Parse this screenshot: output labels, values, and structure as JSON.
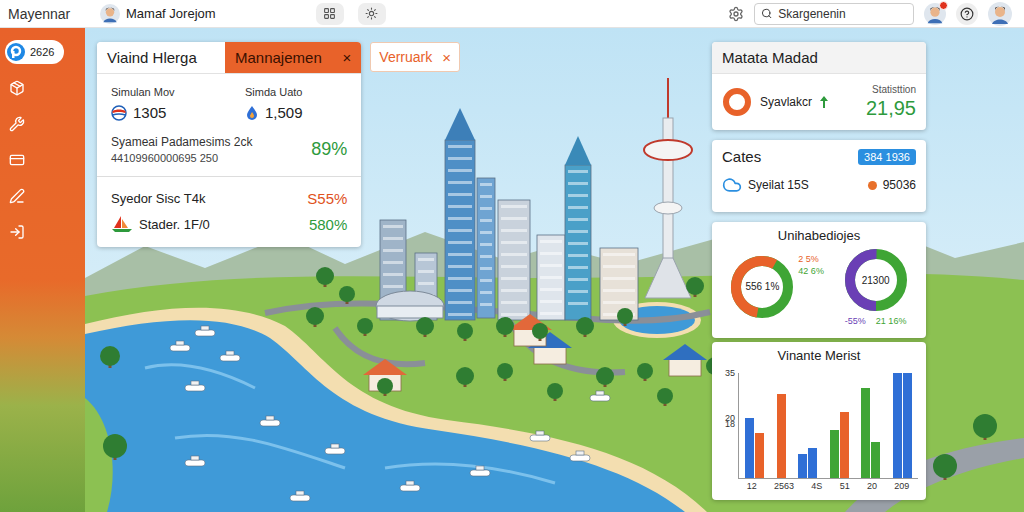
{
  "app": {
    "name": "Mayennar"
  },
  "header": {
    "user": "Mamaf Jorejom",
    "search": {
      "placeholder": "Skargenenin"
    },
    "notification": true
  },
  "sidebar": {
    "items": [
      {
        "label": "2626",
        "selected": true
      },
      {
        "selected": false
      },
      {
        "selected": false
      },
      {
        "selected": false
      },
      {
        "selected": false
      },
      {
        "selected": false
      }
    ]
  },
  "tabs": [
    {
      "label": "Viaind Hlerga",
      "selected": false
    },
    {
      "label": "Mannajemen",
      "selected": true,
      "close": "×"
    },
    {
      "label": "Verruark",
      "selected": false,
      "close": "×"
    }
  ],
  "summary": {
    "stats": [
      {
        "label": "Simulan Mov",
        "value": "1305"
      },
      {
        "label": "Simda Uato",
        "value": "1,509"
      }
    ],
    "highlight": {
      "label": "Syameai Padamesims 2ck",
      "sub": "44109960000695 250",
      "value": "89%",
      "color": "#2e9a3c"
    },
    "rows": [
      {
        "label": "Syedor Sisc T4k",
        "value": "S55%",
        "color": "#e0521d",
        "kind": "plain"
      },
      {
        "label": "Stader. 1F/0",
        "value": "580%",
        "color": "#2e9a3c",
        "kind": "flag"
      }
    ]
  },
  "metric": {
    "title": "Matata Madad",
    "label": "Syavlakcr",
    "trend": "up",
    "caption": "Statisttion",
    "value": "21,95"
  },
  "cates": {
    "title": "Cates",
    "badge": "384 1936",
    "label": "Syeilat 15S",
    "value": "95036"
  },
  "donuts": {
    "title": "Unihabediojes",
    "charts": [
      {
        "kind": "ring",
        "center": "556 1%",
        "level": 0.55,
        "labels": [
          "2 5%",
          "42 6%"
        ],
        "colors": [
          "#e8622a",
          "#3fa535"
        ]
      },
      {
        "kind": "gauge",
        "center": "21300",
        "level": 0.5,
        "labels": [
          "-55%",
          "21 16%"
        ],
        "colors": [
          "#6a3fb5",
          "#3fa535"
        ]
      }
    ]
  },
  "chart": {
    "title": "Vinante Merist",
    "max": 35,
    "yticks": [
      "35",
      "20",
      "18"
    ],
    "groups": [
      {
        "label": "12",
        "bars": [
          {
            "value": 20,
            "color": "#2f6fd6"
          },
          {
            "value": 15,
            "color": "#e8622a"
          }
        ]
      },
      {
        "label": "2563",
        "bars": [
          {
            "value": 28,
            "color": "#e8622a"
          }
        ]
      },
      {
        "label": "4S",
        "bars": [
          {
            "value": 8,
            "color": "#2f6fd6"
          },
          {
            "value": 10,
            "color": "#2f6fd6"
          }
        ]
      },
      {
        "label": "51",
        "bars": [
          {
            "value": 16,
            "color": "#3fa535"
          },
          {
            "value": 22,
            "color": "#e8622a"
          }
        ]
      },
      {
        "label": "20",
        "bars": [
          {
            "value": 30,
            "color": "#3fa535"
          },
          {
            "value": 12,
            "color": "#3fa535"
          }
        ]
      },
      {
        "label": "209",
        "bars": [
          {
            "value": 35,
            "color": "#2f6fd6"
          },
          {
            "value": 35,
            "color": "#2f6fd6"
          }
        ]
      }
    ]
  }
}
